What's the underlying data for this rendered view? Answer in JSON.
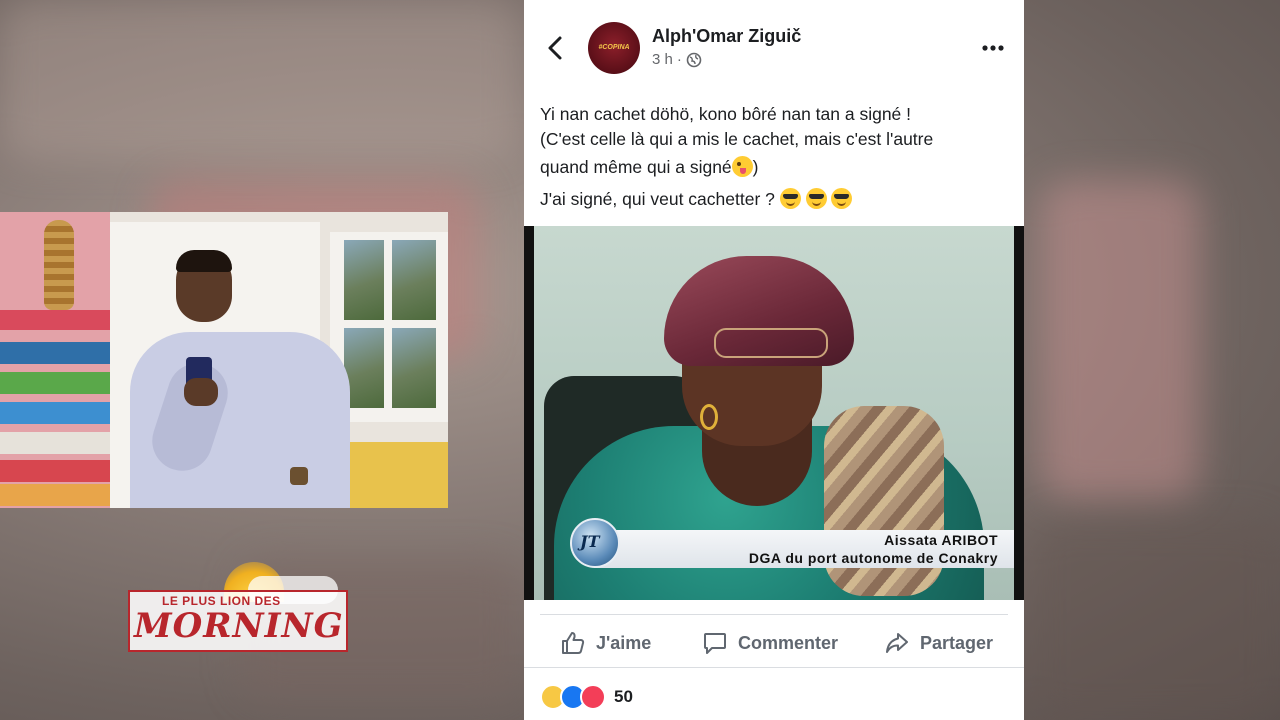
{
  "post": {
    "author": "Alph'Omar Ziguič",
    "time": "3 h",
    "separator": "·",
    "text_lines": [
      "Yi nan cachet döhö, kono bôré nan tan a signé !",
      "(C'est celle là qui a mis le cachet, mais c'est l'autre",
      "quand même qui a signé",
      ")",
      "J'ai signé, qui veut cachetter ? "
    ],
    "media": {
      "caption_name": "Aissata ARIBOT",
      "caption_role": "DGA du port autonome de Conakry",
      "channel_logo": "JT"
    },
    "actions": {
      "like": "J'aime",
      "comment": "Commenter",
      "share": "Partager"
    },
    "reactions": {
      "types": [
        "haha",
        "like",
        "love"
      ],
      "count": "50"
    },
    "icons": {
      "back": "chevron-left-icon",
      "more": "more-horizontal-icon",
      "privacy": "globe-icon"
    }
  },
  "show_logo": {
    "top_line": "LE PLUS LION DES",
    "main": "MORNING"
  },
  "colors": {
    "fb_text": "#1c1e21",
    "fb_secondary": "#65676b",
    "fb_action": "#606770",
    "logo_red": "#b8262c",
    "like_blue": "#1877f2",
    "love_red": "#f33e58"
  }
}
